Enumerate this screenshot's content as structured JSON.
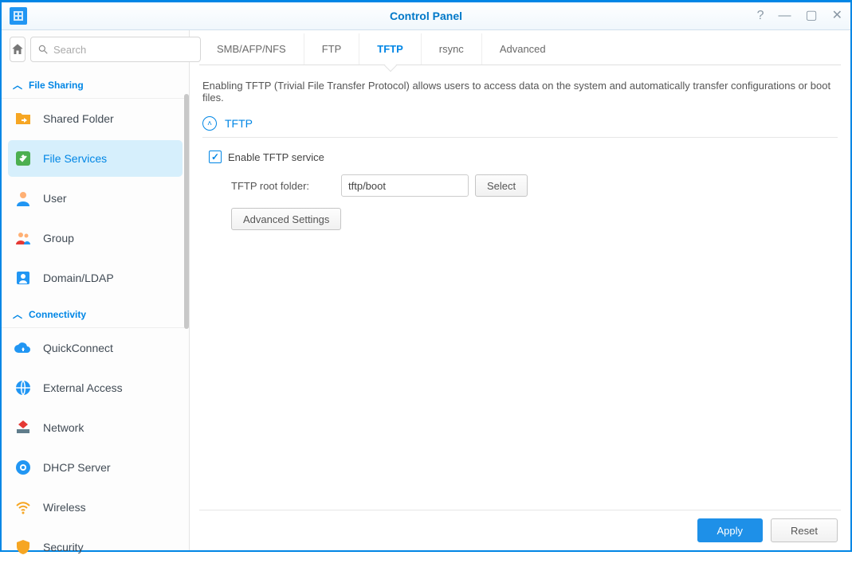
{
  "window": {
    "title": "Control Panel"
  },
  "search": {
    "placeholder": "Search"
  },
  "sidebar": {
    "section1": {
      "label": "File Sharing"
    },
    "section2": {
      "label": "Connectivity"
    },
    "items": [
      {
        "label": "Shared Folder"
      },
      {
        "label": "File Services"
      },
      {
        "label": "User"
      },
      {
        "label": "Group"
      },
      {
        "label": "Domain/LDAP"
      },
      {
        "label": "QuickConnect"
      },
      {
        "label": "External Access"
      },
      {
        "label": "Network"
      },
      {
        "label": "DHCP Server"
      },
      {
        "label": "Wireless"
      },
      {
        "label": "Security"
      }
    ]
  },
  "tabs": [
    {
      "label": "SMB/AFP/NFS"
    },
    {
      "label": "FTP"
    },
    {
      "label": "TFTP"
    },
    {
      "label": "rsync"
    },
    {
      "label": "Advanced"
    }
  ],
  "content": {
    "description": "Enabling TFTP (Trivial File Transfer Protocol) allows users to access data on the system and automatically transfer configurations or boot files.",
    "section_title": "TFTP",
    "enable_label": "Enable TFTP service",
    "root_label": "TFTP root folder:",
    "root_value": "tftp/boot",
    "select_label": "Select",
    "advanced_label": "Advanced Settings"
  },
  "footer": {
    "apply": "Apply",
    "reset": "Reset"
  }
}
